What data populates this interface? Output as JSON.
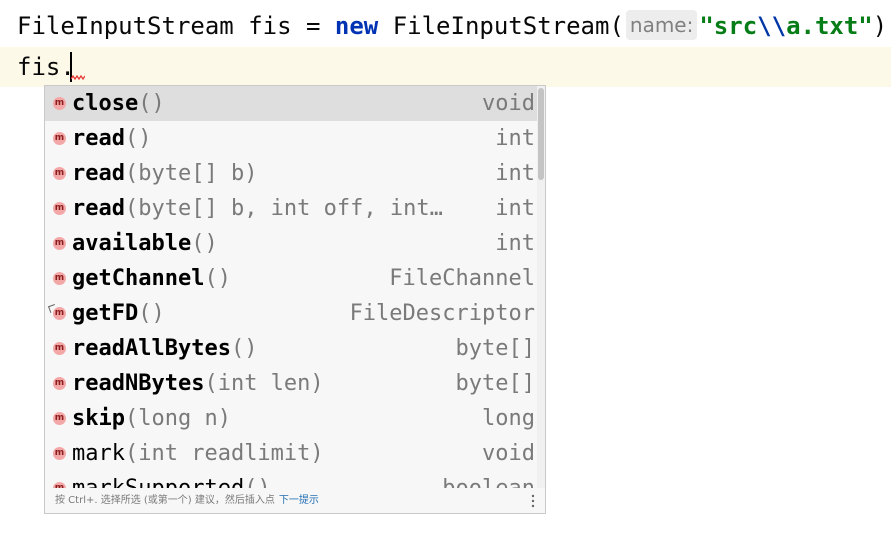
{
  "editor": {
    "line1": {
      "prefix": "FileInputStream fis = ",
      "keyword": "new",
      "middle": " FileInputStream(",
      "param_hint": "name:",
      "string_open": "\"src",
      "string_escape": "\\\\",
      "string_close": "a.txt\"",
      "suffix": ");"
    },
    "line2": {
      "text": "fis."
    }
  },
  "completion": {
    "items": [
      {
        "name": "close",
        "params": "()",
        "type": "void",
        "bold": true,
        "selected": true
      },
      {
        "name": "read",
        "params": "()",
        "type": "int",
        "bold": true
      },
      {
        "name": "read",
        "params": "(byte[] b)",
        "type": "int",
        "bold": true
      },
      {
        "name": "read",
        "params": "(byte[] b, int off, int…",
        "type": "int",
        "bold": true
      },
      {
        "name": "available",
        "params": "()",
        "type": "int",
        "bold": true
      },
      {
        "name": "getChannel",
        "params": "()",
        "type": "FileChannel",
        "bold": true
      },
      {
        "name": "getFD",
        "params": "()",
        "type": "FileDescriptor",
        "bold": true,
        "locked": true
      },
      {
        "name": "readAllBytes",
        "params": "()",
        "type": "byte[]",
        "bold": true
      },
      {
        "name": "readNBytes",
        "params": "(int len)",
        "type": "byte[]",
        "bold": true
      },
      {
        "name": "skip",
        "params": "(long n)",
        "type": "long",
        "bold": true
      },
      {
        "name": "mark",
        "params": "(int readlimit)",
        "type": "void",
        "bold": false
      },
      {
        "name": "markSupported",
        "params": "()",
        "type": "boolean",
        "bold": false
      }
    ],
    "icon_letter": "m",
    "footer": {
      "hint": "按 Ctrl+. 选择所选 (或第一个) 建议，然后插入点",
      "next_tip": "下一提示"
    }
  }
}
